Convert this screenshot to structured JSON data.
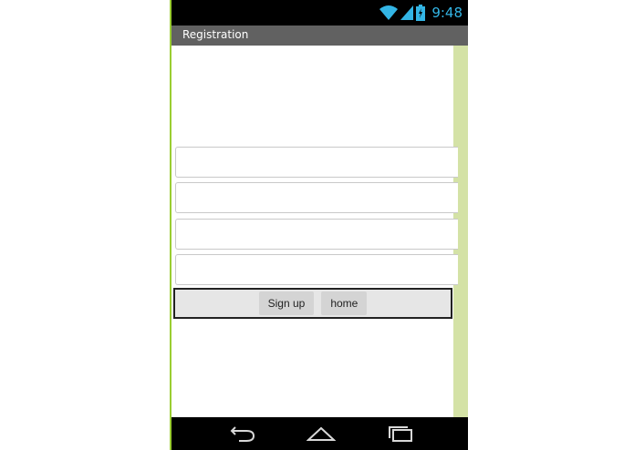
{
  "status_bar": {
    "time": "9:48",
    "icons": [
      "wifi-icon",
      "signal-icon",
      "battery-icon"
    ],
    "accent_color": "#33b5e5"
  },
  "title_bar": {
    "title": "Registration"
  },
  "form": {
    "fields": [
      {
        "value": "",
        "placeholder": ""
      },
      {
        "value": "",
        "placeholder": ""
      },
      {
        "value": "",
        "placeholder": ""
      },
      {
        "value": "",
        "placeholder": ""
      }
    ],
    "signup_label": "Sign up",
    "home_label": "home"
  },
  "nav_bar": {
    "icons": [
      "back-icon",
      "home-icon",
      "recent-apps-icon"
    ]
  },
  "colors": {
    "frame_border": "#9acd32",
    "scroll_strip": "#d4e2a6",
    "title_bar": "#616161"
  }
}
